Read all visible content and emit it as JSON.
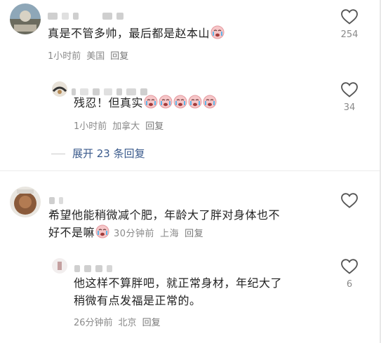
{
  "comments": [
    {
      "text": "真是不管多帅，最后都是赵本山",
      "emoji": "crying-face-emoji",
      "time": "1小时前",
      "location": "美国",
      "reply_label": "回复",
      "likes": "254",
      "reply": {
        "text": "残忍！但真实",
        "emoji_count": 5,
        "time": "1小时前",
        "location": "加拿大",
        "reply_label": "回复",
        "likes": "34"
      },
      "expand_label": "展开 23 条回复"
    },
    {
      "text_line1": "希望他能稍微减个肥，年龄大了胖对身体也不",
      "text_line2": "好不是嘛",
      "time": "30分钟前",
      "location": "上海",
      "reply_label": "回复",
      "likes": "",
      "reply": {
        "text_line1": "他这样不算胖吧，就正常身材，年纪大了",
        "text_line2": "稍微有点发福是正常的。",
        "time": "26分钟前",
        "location": "北京",
        "reply_label": "回复",
        "likes": "6"
      }
    }
  ],
  "colors": {
    "text": "#222222",
    "meta": "#8a8a8a",
    "link": "#3a5a8c",
    "emoji_face": "#f6c6c8"
  }
}
